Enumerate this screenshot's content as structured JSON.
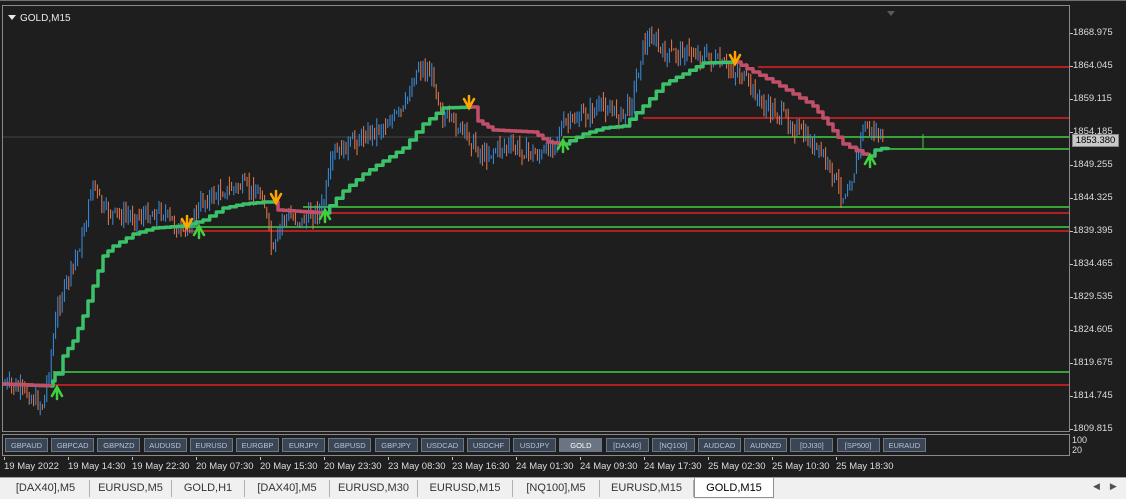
{
  "chart": {
    "symbol_label": "GOLD,M15",
    "current_price": "1853.380",
    "price_ticks": [
      "1868.975",
      "1864.045",
      "1859.115",
      "1854.185",
      "1849.255",
      "1844.325",
      "1839.395",
      "1834.465",
      "1829.535",
      "1824.605",
      "1819.675",
      "1814.745",
      "1809.815"
    ],
    "time_ticks": [
      "19 May 2022",
      "19 May 14:30",
      "19 May 22:30",
      "20 May 07:30",
      "20 May 15:30",
      "20 May 23:30",
      "23 May 08:30",
      "23 May 16:30",
      "24 May 01:30",
      "24 May 09:30",
      "24 May 17:30",
      "25 May 02:30",
      "25 May 10:30",
      "25 May 18:30"
    ],
    "osc_scale": [
      "100",
      "20"
    ],
    "colors": {
      "background": "#1e1e1e",
      "bull_candle": "#3b8fe0",
      "bear_candle": "#e87a50",
      "trend_up": "#3cc06a",
      "trend_down": "#c0506a",
      "support_line": "#40d040",
      "resistance_line": "#e02020",
      "arrow_up": "#40d040",
      "arrow_down": "#ffa500"
    },
    "icons": {
      "symbol_menu": "triangle-down-icon",
      "buy_signal": "arrow-up-icon",
      "sell_signal": "arrow-down-icon"
    }
  },
  "symbols_bar": {
    "buttons": [
      "GBPAUD",
      "GBPCAD",
      "GBPNZD",
      "AUDUSD",
      "EURUSD",
      "EURGBP",
      "EURJPY",
      "GBPUSD",
      "GBPJPY",
      "USDCAD",
      "USDCHF",
      "USDJPY",
      "GOLD",
      "[DAX40]",
      "[NQ100]",
      "AUDCAD",
      "AUDNZD",
      "[DJI30]",
      "[SP500]",
      "EURAUD"
    ],
    "active": "GOLD"
  },
  "tabs": {
    "items": [
      "[DAX40],M5",
      "EURUSD,M5",
      "GOLD,H1",
      "[DAX40],M5",
      "EURUSD,M30",
      "EURUSD,M15",
      "[NQ100],M5",
      "EURUSD,M15",
      "GOLD,M15"
    ],
    "active": "GOLD,M15",
    "scroll_icons": [
      "triangle-left-icon",
      "triangle-right-icon"
    ]
  }
}
